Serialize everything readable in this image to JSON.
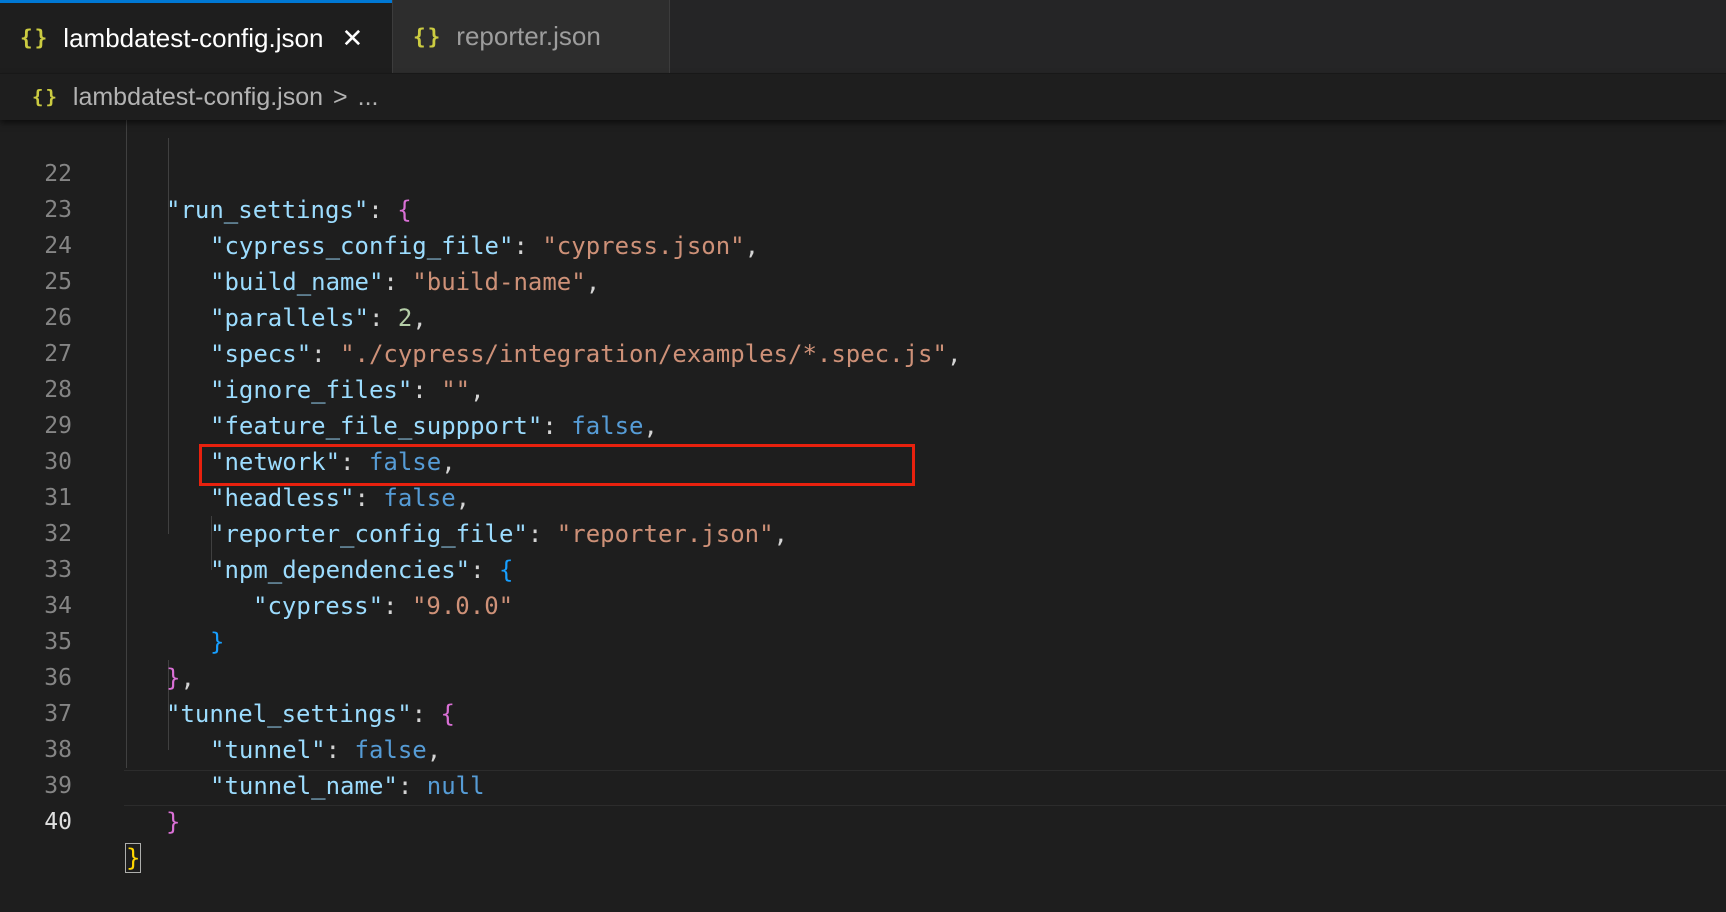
{
  "tabs": [
    {
      "icon": "{}",
      "label": "lambdatest-config.json",
      "active": true
    },
    {
      "icon": "{}",
      "label": "reporter.json",
      "active": false
    }
  ],
  "breadcrumb": {
    "icon": "{}",
    "file": "lambdatest-config.json",
    "separator": ">",
    "ellipsis": "..."
  },
  "editor": {
    "line_numbers": [
      "22",
      "23",
      "24",
      "25",
      "26",
      "27",
      "28",
      "29",
      "30",
      "31",
      "32",
      "33",
      "34",
      "35",
      "36",
      "37",
      "38",
      "39",
      "40"
    ],
    "code": {
      "l22": {
        "key": "\"run_settings\"",
        "brace": "{"
      },
      "l23": {
        "key": "\"cypress_config_file\"",
        "value": "\"cypress.json\""
      },
      "l24": {
        "key": "\"build_name\"",
        "value": "\"build-name\""
      },
      "l25": {
        "key": "\"parallels\"",
        "value": "2"
      },
      "l26": {
        "key": "\"specs\"",
        "value": "\"./cypress/integration/examples/*.spec.js\""
      },
      "l27": {
        "key": "\"ignore_files\"",
        "value": "\"\""
      },
      "l28": {
        "key": "\"feature_file_suppport\"",
        "value": "false"
      },
      "l29": {
        "key": "\"network\"",
        "value": "false"
      },
      "l30": {
        "key": "\"headless\"",
        "value": "false"
      },
      "l31": {
        "key": "\"reporter_config_file\"",
        "value": "\"reporter.json\""
      },
      "l32": {
        "key": "\"npm_dependencies\"",
        "brace": "{"
      },
      "l33": {
        "key": "\"cypress\"",
        "value": "\"9.0.0\""
      },
      "l34": {
        "brace": "}"
      },
      "l35": {
        "brace": "}"
      },
      "l36": {
        "key": "\"tunnel_settings\"",
        "brace": "{"
      },
      "l37": {
        "key": "\"tunnel\"",
        "value": "false"
      },
      "l38": {
        "key": "\"tunnel_name\"",
        "value": "null"
      },
      "l39": {
        "brace": "}"
      },
      "l40": {
        "brace": "}"
      }
    }
  },
  "colors": {
    "background": "#1e1e1e",
    "key": "#9cdcfe",
    "string": "#ce9178",
    "number": "#b5cea8",
    "keyword": "#569cd6",
    "highlight_box": "#e8210e",
    "active_tab_accent": "#0078d4"
  }
}
